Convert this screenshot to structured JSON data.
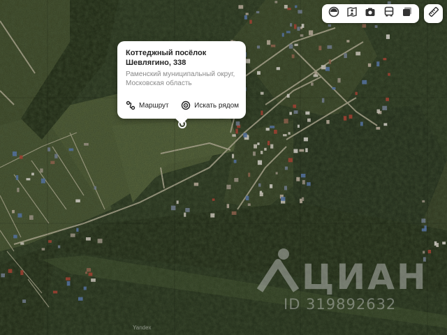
{
  "map": {
    "style": "satellite",
    "colors": {
      "forest": "#2d3a22",
      "field": "#4a5733",
      "road": "#c9c2a8"
    }
  },
  "popup": {
    "title": "Коттеджный посёлок Шевлягино, 338",
    "subtitle": "Раменский муниципальный округ, Московская область",
    "route_label": "Маршрут",
    "search_nearby_label": "Искать рядом",
    "route_icon": "route-icon",
    "search_icon": "search-nearby-icon"
  },
  "toolbar": {
    "layers": [
      {
        "name": "map-layers-icon"
      },
      {
        "name": "panorama-icon"
      },
      {
        "name": "photos-icon"
      },
      {
        "name": "transport-icon"
      },
      {
        "name": "copy-layers-icon"
      }
    ],
    "ruler": "ruler-icon"
  },
  "watermark": {
    "brand": "ЦИАН",
    "id_text": "ID 319892632"
  },
  "attribution": "Yandex"
}
